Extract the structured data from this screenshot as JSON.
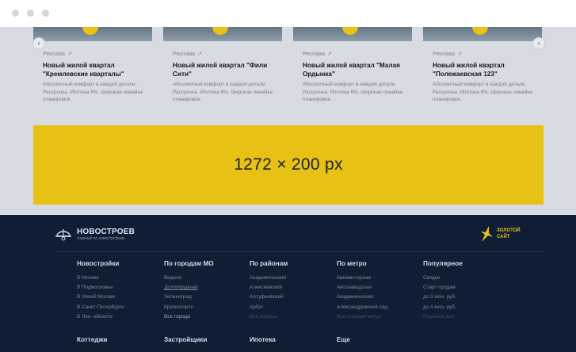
{
  "cards": [
    {
      "ad_label": "Реклама",
      "title": "Новый жилой квартал \"Кремлевские кварталы\"",
      "description": "Абсолютный комфорт в каждой детали. Рассрочка. Ипотека 6%. Широкая линейка планировок."
    },
    {
      "ad_label": "Реклама",
      "title": "Новый жилой квартал \"Фили Сити\"",
      "description": "Абсолютный комфорт в каждой детали. Рассрочка. Ипотека 6%. Широкая линейка планировок."
    },
    {
      "ad_label": "Реклама",
      "title": "Новый жилой квартал \"Малая Ордынка\"",
      "description": "Абсолютный комфорт в каждой детали. Рассрочка. Ипотека 6%. Широкая линейка планировок."
    },
    {
      "ad_label": "Реклама",
      "title": "Новый жилой квартал \"Полежаевская 123\"",
      "description": "Абсолютный комфорт в каждой детали. Рассрочка. Ипотека 6%. Широкая линейка планировок."
    }
  ],
  "carousel": {
    "prev_icon": "‹",
    "next_icon": "›"
  },
  "banner": {
    "text": "1272 × 200 px"
  },
  "footer": {
    "logo": {
      "name": "НОВОСТРОЕВ",
      "tagline": "главный по новостройкам"
    },
    "award": {
      "line1": "ЗОЛОТОЙ",
      "line2": "САЙТ"
    },
    "columns": [
      {
        "title": "Новостройки",
        "items": [
          "В Москве",
          "В Подмосковье",
          "В Новой Москве",
          "В Санкт-Петербурге",
          "В Лен. области"
        ]
      },
      {
        "title": "По городам МО",
        "items": [
          "Видное",
          "Долгопрудный",
          "Зеленоград",
          "Красногорск"
        ],
        "more": "Все города"
      },
      {
        "title": "По районам",
        "items": [
          "Академический",
          "Алексеевский",
          "Алтуфьевский",
          "Арбат"
        ],
        "more": "Все районы"
      },
      {
        "title": "По метро",
        "items": [
          "Авиамоторная",
          "Автозаводская",
          "Академическая",
          "Александровский сад"
        ],
        "more": "Все станции метро"
      },
      {
        "title": "Популярное",
        "items": [
          "Скидки",
          "Старт продаж",
          "до 3 млн. руб.",
          "до 4 млн. руб."
        ],
        "more": "Показать все"
      }
    ],
    "row2": [
      "Коттеджи",
      "Застройщики",
      "Ипотека",
      "Еще"
    ]
  },
  "colors": {
    "accent": "#ffd30a",
    "footer_bg": "#0f1e34"
  }
}
